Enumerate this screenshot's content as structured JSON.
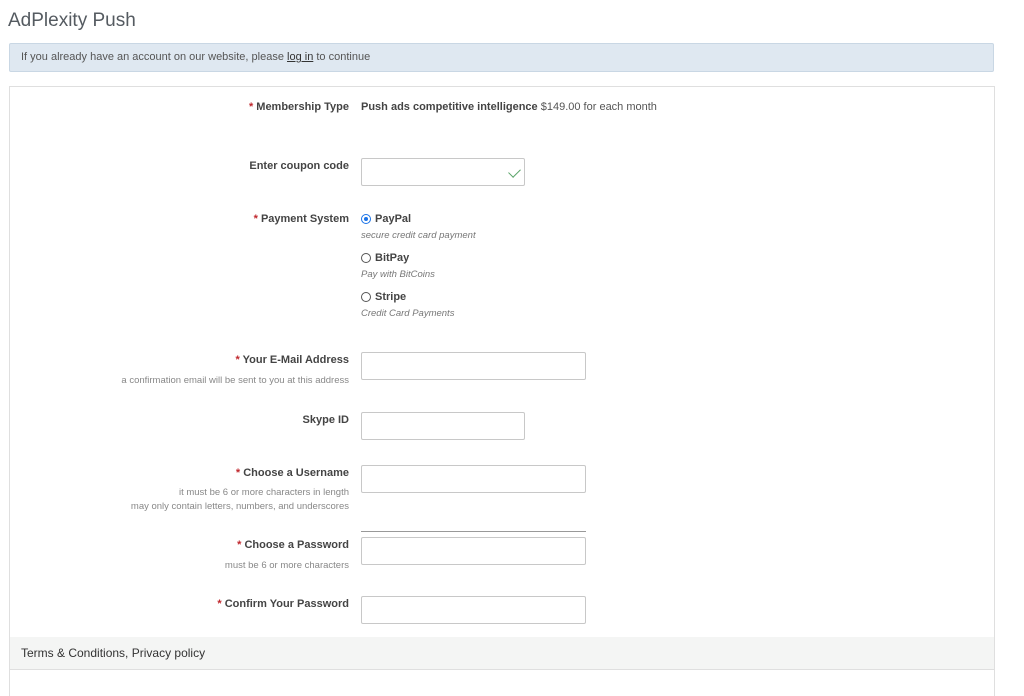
{
  "header": {
    "title": "AdPlexity Push"
  },
  "notice": {
    "before": "If you already have an account on our website, please",
    "link": "log in",
    "after": "to continue"
  },
  "form": {
    "membership": {
      "label": "Membership Type",
      "product": "Push ads competitive intelligence",
      "price": "$149.00 for each month"
    },
    "coupon": {
      "label": "Enter coupon code",
      "value": ""
    },
    "payment": {
      "label": "Payment System",
      "options": [
        {
          "name": "PayPal",
          "desc": "secure credit card payment",
          "selected": true
        },
        {
          "name": "BitPay",
          "desc": "Pay with BitCoins",
          "selected": false
        },
        {
          "name": "Stripe",
          "desc": "Credit Card Payments",
          "selected": false
        }
      ]
    },
    "email": {
      "label": "Your E-Mail Address",
      "hint": "a confirmation email will be sent to you at this address",
      "value": ""
    },
    "skype": {
      "label": "Skype ID",
      "value": ""
    },
    "username": {
      "label": "Choose a Username",
      "hint1": "it must be 6 or more characters in length",
      "hint2": "may only contain letters, numbers, and underscores",
      "value": ""
    },
    "password": {
      "label": "Choose a Password",
      "hint": "must be 6 or more characters",
      "value": ""
    },
    "confirm": {
      "label": "Confirm Your Password",
      "value": ""
    },
    "required_mark": "*"
  },
  "terms": {
    "terms_link": "Terms & Conditions",
    "separator": ",",
    "privacy_link": "Privacy policy"
  }
}
